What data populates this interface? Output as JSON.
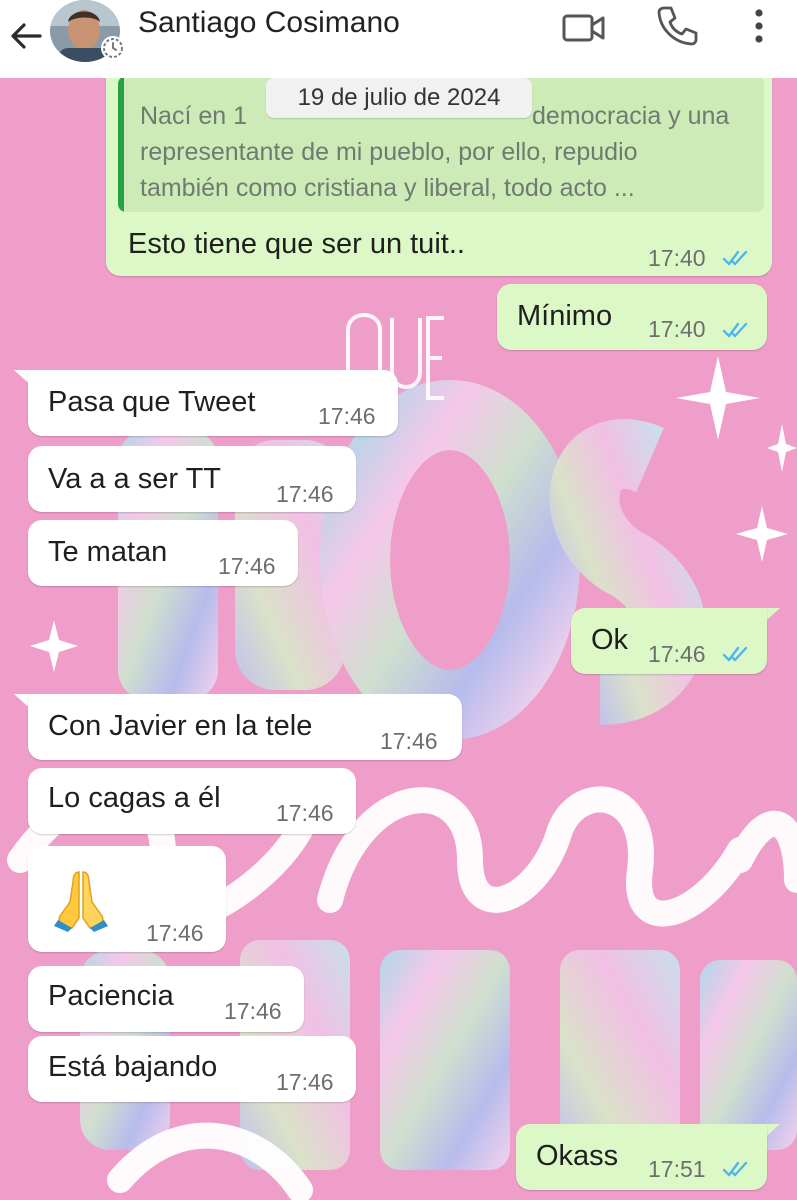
{
  "header": {
    "contact_name": "Santiago Cosimano",
    "back_icon": "arrow-left-icon",
    "video_icon": "video-camera-icon",
    "call_icon": "phone-icon",
    "menu_icon": "more-vertical-icon"
  },
  "date_chip": "19 de julio de 2024",
  "quoted_message": {
    "line1": "Nací en 1",
    "line1_end": "democracia y una",
    "line2": "representante de mi pueblo, por ello, repudio",
    "line3": "también como cristiana y liberal, todo acto ..."
  },
  "messages": [
    {
      "direction": "outgoing",
      "text": "Esto tiene que ser un tuit..",
      "time": "17:40",
      "status": "read"
    },
    {
      "direction": "outgoing",
      "text": "Mínimo",
      "time": "17:40",
      "status": "read"
    },
    {
      "direction": "incoming",
      "text": "Pasa que Tweet",
      "time": "17:46"
    },
    {
      "direction": "incoming",
      "text": "Va a a ser TT",
      "time": "17:46"
    },
    {
      "direction": "incoming",
      "text": "Te matan",
      "time": "17:46"
    },
    {
      "direction": "outgoing",
      "text": "Ok",
      "time": "17:46",
      "status": "read"
    },
    {
      "direction": "incoming",
      "text": "Con Javier en la tele",
      "time": "17:46"
    },
    {
      "direction": "incoming",
      "text": "Lo cagas a él",
      "time": "17:46"
    },
    {
      "direction": "incoming",
      "text": "",
      "emoji": "folded-hands-emoji",
      "time": "17:46"
    },
    {
      "direction": "incoming",
      "text": "Paciencia",
      "time": "17:46"
    },
    {
      "direction": "incoming",
      "text": "Está bajando",
      "time": "17:46"
    },
    {
      "direction": "outgoing",
      "text": "Okass",
      "time": "17:51",
      "status": "read"
    }
  ],
  "colors": {
    "wallpaper": "#ef9ec9",
    "incoming_bubble": "#ffffff",
    "outgoing_bubble": "#dcf8c6",
    "read_ticks": "#4fb6ec",
    "quote_bar": "#25a244"
  }
}
